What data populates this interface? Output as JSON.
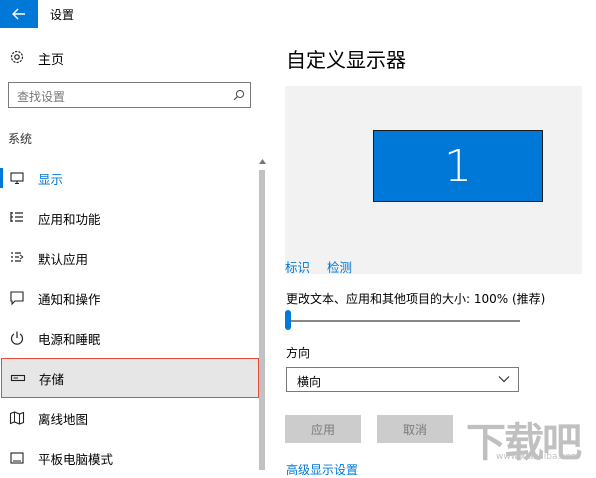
{
  "window": {
    "title": "设置"
  },
  "sidebar": {
    "home_label": "主页",
    "search_placeholder": "查找设置",
    "section_label": "系统",
    "items": [
      {
        "label": "显示",
        "icon": "monitor-icon",
        "active": true
      },
      {
        "label": "应用和功能",
        "icon": "apps-list-icon"
      },
      {
        "label": "默认应用",
        "icon": "default-apps-icon"
      },
      {
        "label": "通知和操作",
        "icon": "notification-icon"
      },
      {
        "label": "电源和睡眠",
        "icon": "power-icon"
      },
      {
        "label": "存储",
        "icon": "storage-icon",
        "hover": true
      },
      {
        "label": "离线地图",
        "icon": "map-icon"
      },
      {
        "label": "平板电脑模式",
        "icon": "tablet-icon"
      }
    ]
  },
  "main": {
    "title": "自定义显示器",
    "monitor_number": "1",
    "links": {
      "identify": "标识",
      "detect": "检测"
    },
    "scale_label": "更改文本、应用和其他项目的大小: 100% (推荐)",
    "scale_level": 0,
    "orientation_label": "方向",
    "orientation_value": "横向",
    "apply_label": "应用",
    "cancel_label": "取消",
    "advanced_link": "高级显示设置"
  },
  "watermark": {
    "text": "下载吧",
    "url": "www.xiazaiba.com"
  },
  "colors": {
    "accent": "#0078d7",
    "hover_border": "#e74c3c",
    "disabled_button": "#cccccc"
  }
}
